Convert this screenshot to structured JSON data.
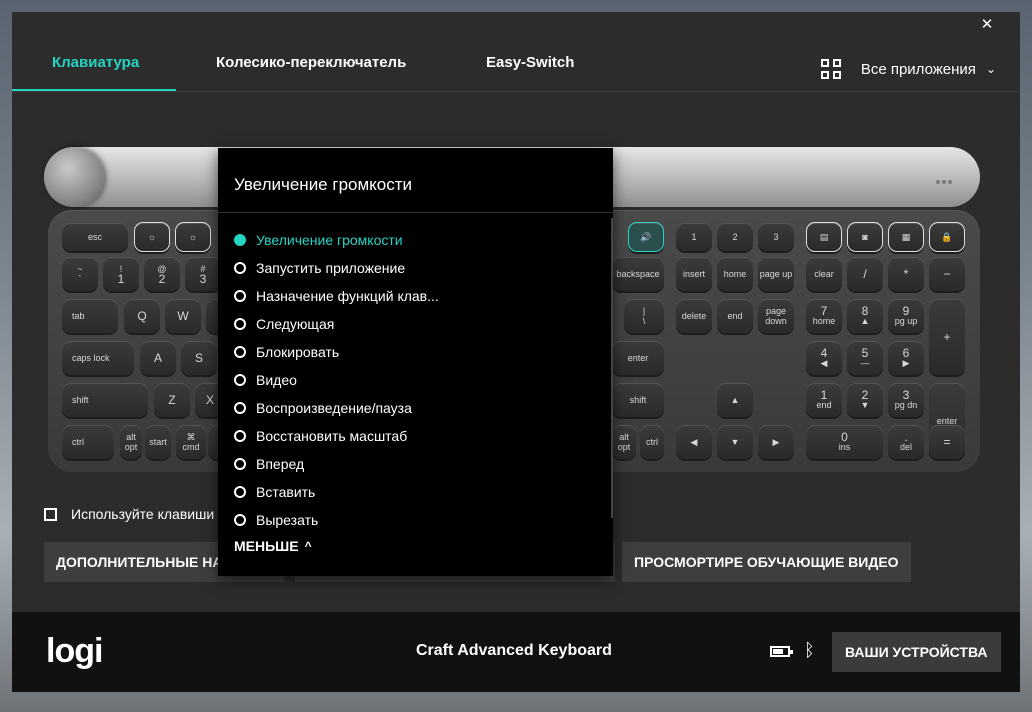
{
  "window": {
    "close_glyph": "✕"
  },
  "tabs": [
    {
      "label": "Клавиатура",
      "active": true
    },
    {
      "label": "Колесико-переключатель",
      "active": false
    },
    {
      "label": "Easy-Switch",
      "active": false
    }
  ],
  "app_selector": {
    "label": "Все приложения",
    "icon": "grid-icon",
    "chevron": "⌄"
  },
  "keyboard": {
    "keys": {
      "esc": "esc",
      "f1": "☼",
      "f2": "☼",
      "volume_up": "🔊",
      "n1": "1",
      "n2": "2",
      "n3": "3",
      "backquote": "~",
      "backquote_sub": "`",
      "k1": "!",
      "k1_sub": "1",
      "k2": "@",
      "k2_sub": "2",
      "k3": "#",
      "k3_sub": "3",
      "tab": "tab",
      "q": "Q",
      "w": "W",
      "capslock": "caps lock",
      "a": "A",
      "s": "S",
      "shift_l": "shift",
      "z": "Z",
      "x": "X",
      "ctrl_l": "ctrl",
      "alt_l": "alt",
      "alt_l_sub": "opt",
      "start": "start",
      "cmd_l": "⌘",
      "cmd_l_sub": "cmd",
      "backspace": "backspace",
      "backslash": "|",
      "backslash_sub": "\\",
      "enter": "enter",
      "shift_r": "shift",
      "alt_r": "alt",
      "alt_r_sub": "opt",
      "ctrl_r": "ctrl",
      "insert": "insert",
      "home": "home",
      "pageup": "page\nup",
      "delete": "delete",
      "end": "end",
      "pagedown": "page\ndown",
      "arrow_up": "▲",
      "arrow_left": "◀",
      "arrow_down": "▼",
      "arrow_right": "▶",
      "clear": "clear",
      "slash": "/",
      "asterisk": "*",
      "minus": "−",
      "n7": "7",
      "n7_sub": "home",
      "n8": "8",
      "n8_sub": "▲",
      "n9": "9",
      "n9_sub": "pg up",
      "plus": "+",
      "n4": "4",
      "n4_sub": "◀",
      "n5": "5",
      "n5_sub": "—",
      "n6": "6",
      "n6_sub": "▶",
      "nn1": "1",
      "nn1_sub": "end",
      "nn2": "2",
      "nn2_sub": "▼",
      "nn3": "3",
      "nn3_sub": "pg dn",
      "numenter": "enter",
      "n0": "0",
      "n0_sub": "ins",
      "dot": ".",
      "dot_sub": "del",
      "equals": "="
    }
  },
  "dropdown": {
    "title": "Увеличение громкости",
    "items": [
      {
        "label": "Увеличение громкости",
        "selected": true
      },
      {
        "label": "Запустить приложение",
        "selected": false
      },
      {
        "label": "Назначение функций клав...",
        "selected": false
      },
      {
        "label": "Следующая",
        "selected": false
      },
      {
        "label": "Блокировать",
        "selected": false
      },
      {
        "label": "Видео",
        "selected": false
      },
      {
        "label": "Воспроизведение/пауза",
        "selected": false
      },
      {
        "label": "Восстановить масштаб",
        "selected": false
      },
      {
        "label": "Вперед",
        "selected": false
      },
      {
        "label": "Вставить",
        "selected": false
      },
      {
        "label": "Вырезать",
        "selected": false
      }
    ],
    "less_label": "МЕНЬШЕ",
    "less_caret": "^"
  },
  "fkeys_option": {
    "label": "Используйте клавиши F",
    "checked": false
  },
  "buttons": {
    "more_settings": "ДОПОЛНИТЕЛЬНЫЕ НАС",
    "tutorial_videos": "ПРОСМОРТИРЕ ОБУЧАЮЩИЕ ВИДЕО"
  },
  "footer": {
    "logo": "logi",
    "device_name": "Craft Advanced Keyboard",
    "bluetooth_glyph": "ᛒ",
    "devices_button": "ВАШИ УСТРОЙСТВА"
  },
  "colors": {
    "accent": "#26d4c4",
    "window_bg": "#2c2c2c",
    "footer_bg": "#111111"
  }
}
